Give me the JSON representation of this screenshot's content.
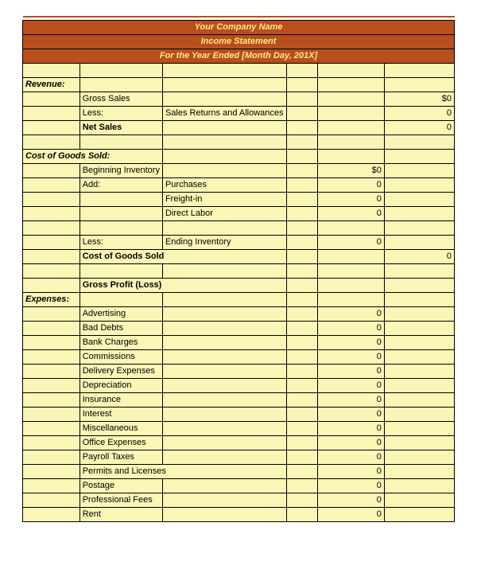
{
  "header": {
    "company": "Your Company Name",
    "title": "Income Statement",
    "period": "For the Year Ended [Month Day, 201X]"
  },
  "sections": {
    "revenue": "Revenue:",
    "cogs": "Cost of Goods Sold:",
    "expenses": "Expenses:"
  },
  "labels": {
    "gross_sales": "Gross Sales",
    "less": "Less:",
    "sales_returns": "Sales Returns and Allowances",
    "net_sales": "Net Sales",
    "beginning_inventory": "Beginning Inventory",
    "add": "Add:",
    "purchases": "Purchases",
    "freight_in": "Freight-in",
    "direct_labor": "Direct Labor",
    "ending_inventory": "Ending Inventory",
    "cogs_total": "Cost of Goods Sold",
    "gross_profit": "Gross Profit (Loss)",
    "advertising": "Advertising",
    "bad_debts": "Bad Debts",
    "bank_charges": "Bank Charges",
    "commissions": "Commissions",
    "delivery_expenses": "Delivery Expenses",
    "depreciation": "Depreciation",
    "insurance": "Insurance",
    "interest": "Interest",
    "miscellaneous": "Miscellaneous",
    "office_expenses": "Office Expenses",
    "payroll_taxes": "Payroll Taxes",
    "permits_licenses": "Permits and Licenses",
    "postage": "Postage",
    "professional_fees": "Professional Fees",
    "rent": "Rent"
  },
  "values": {
    "gross_sales": "$0",
    "sales_returns": "0",
    "net_sales": "0",
    "beginning_inventory": "$0",
    "purchases": "0",
    "freight_in": "0",
    "direct_labor": "0",
    "ending_inventory": "0",
    "cogs_total": "0",
    "advertising": "0",
    "bad_debts": "0",
    "bank_charges": "0",
    "commissions": "0",
    "delivery_expenses": "0",
    "depreciation": "0",
    "insurance": "0",
    "interest": "0",
    "miscellaneous": "0",
    "office_expenses": "0",
    "payroll_taxes": "0",
    "permits_licenses": "0",
    "postage": "0",
    "professional_fees": "0",
    "rent": "0"
  }
}
